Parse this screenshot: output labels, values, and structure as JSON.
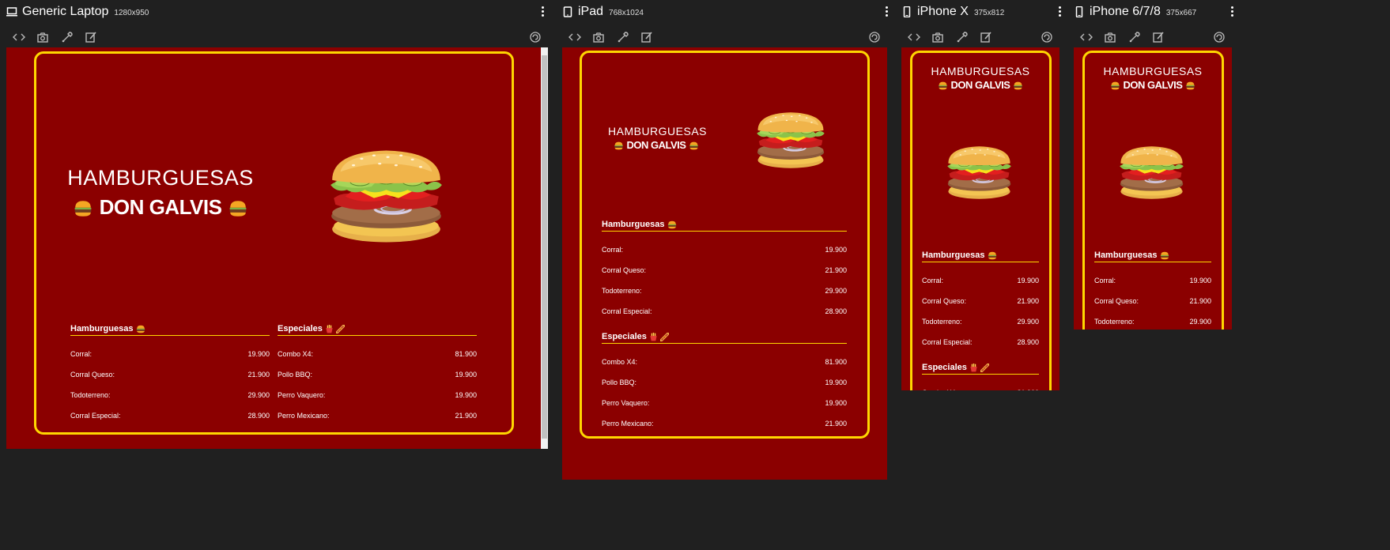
{
  "devices": {
    "laptop": {
      "name": "Generic Laptop",
      "size": "1280x950"
    },
    "ipad": {
      "name": "iPad",
      "size": "768x1024"
    },
    "iphonex": {
      "name": "iPhone X",
      "size": "375x812"
    },
    "iphone8": {
      "name": "iPhone 6/7/8",
      "size": "375x667"
    }
  },
  "site": {
    "title_line1": "HAMBURGUESAS",
    "title_line2": "DON GALVIS",
    "hamburguesas": {
      "title": "Hamburguesas",
      "items": [
        {
          "name": "Corral:",
          "price": "19.900"
        },
        {
          "name": "Corral Queso:",
          "price": "21.900"
        },
        {
          "name": "Todoterreno:",
          "price": "29.900"
        },
        {
          "name": "Corral Especial:",
          "price": "28.900"
        }
      ]
    },
    "especiales": {
      "title": "Especiales",
      "items": [
        {
          "name": "Combo X4:",
          "price": "81.900"
        },
        {
          "name": "Pollo BBQ:",
          "price": "19.900"
        },
        {
          "name": "Perro Vaquero:",
          "price": "19.900"
        },
        {
          "name": "Perro Mexicano:",
          "price": "21.900"
        }
      ]
    }
  },
  "colors": {
    "background": "#202020",
    "page": "#8b0000",
    "accent": "#ffd700"
  },
  "icons": [
    "laptop-icon",
    "tablet-icon",
    "phone-icon",
    "more-vert-icon",
    "code-icon",
    "camera-icon",
    "eyedropper-icon",
    "edit-icon",
    "rotate-icon",
    "burger-icon",
    "fries-icon",
    "hotdog-icon"
  ]
}
